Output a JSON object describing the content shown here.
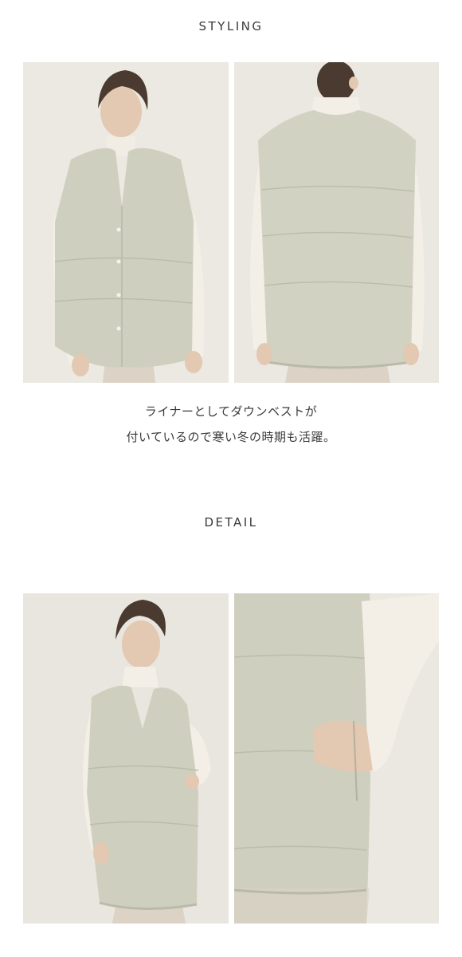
{
  "styling": {
    "heading": "STYLING",
    "photos": [
      {
        "alt": "model wearing vest, front view"
      },
      {
        "alt": "model wearing vest, back view"
      }
    ],
    "caption_line1": "ライナーとしてダウンベストが",
    "caption_line2": "付いているので寒い冬の時期も活躍。"
  },
  "detail": {
    "heading": "DETAIL",
    "photos": [
      {
        "alt": "model wearing vest, three-quarter view"
      },
      {
        "alt": "close-up of side pocket with hand"
      }
    ]
  },
  "colors": {
    "background": "#ffffff",
    "text": "#3a3a3a",
    "vest": "#cfcfbf",
    "photo_backdrop": "#e8e4de",
    "sweater": "#f3efe6"
  }
}
